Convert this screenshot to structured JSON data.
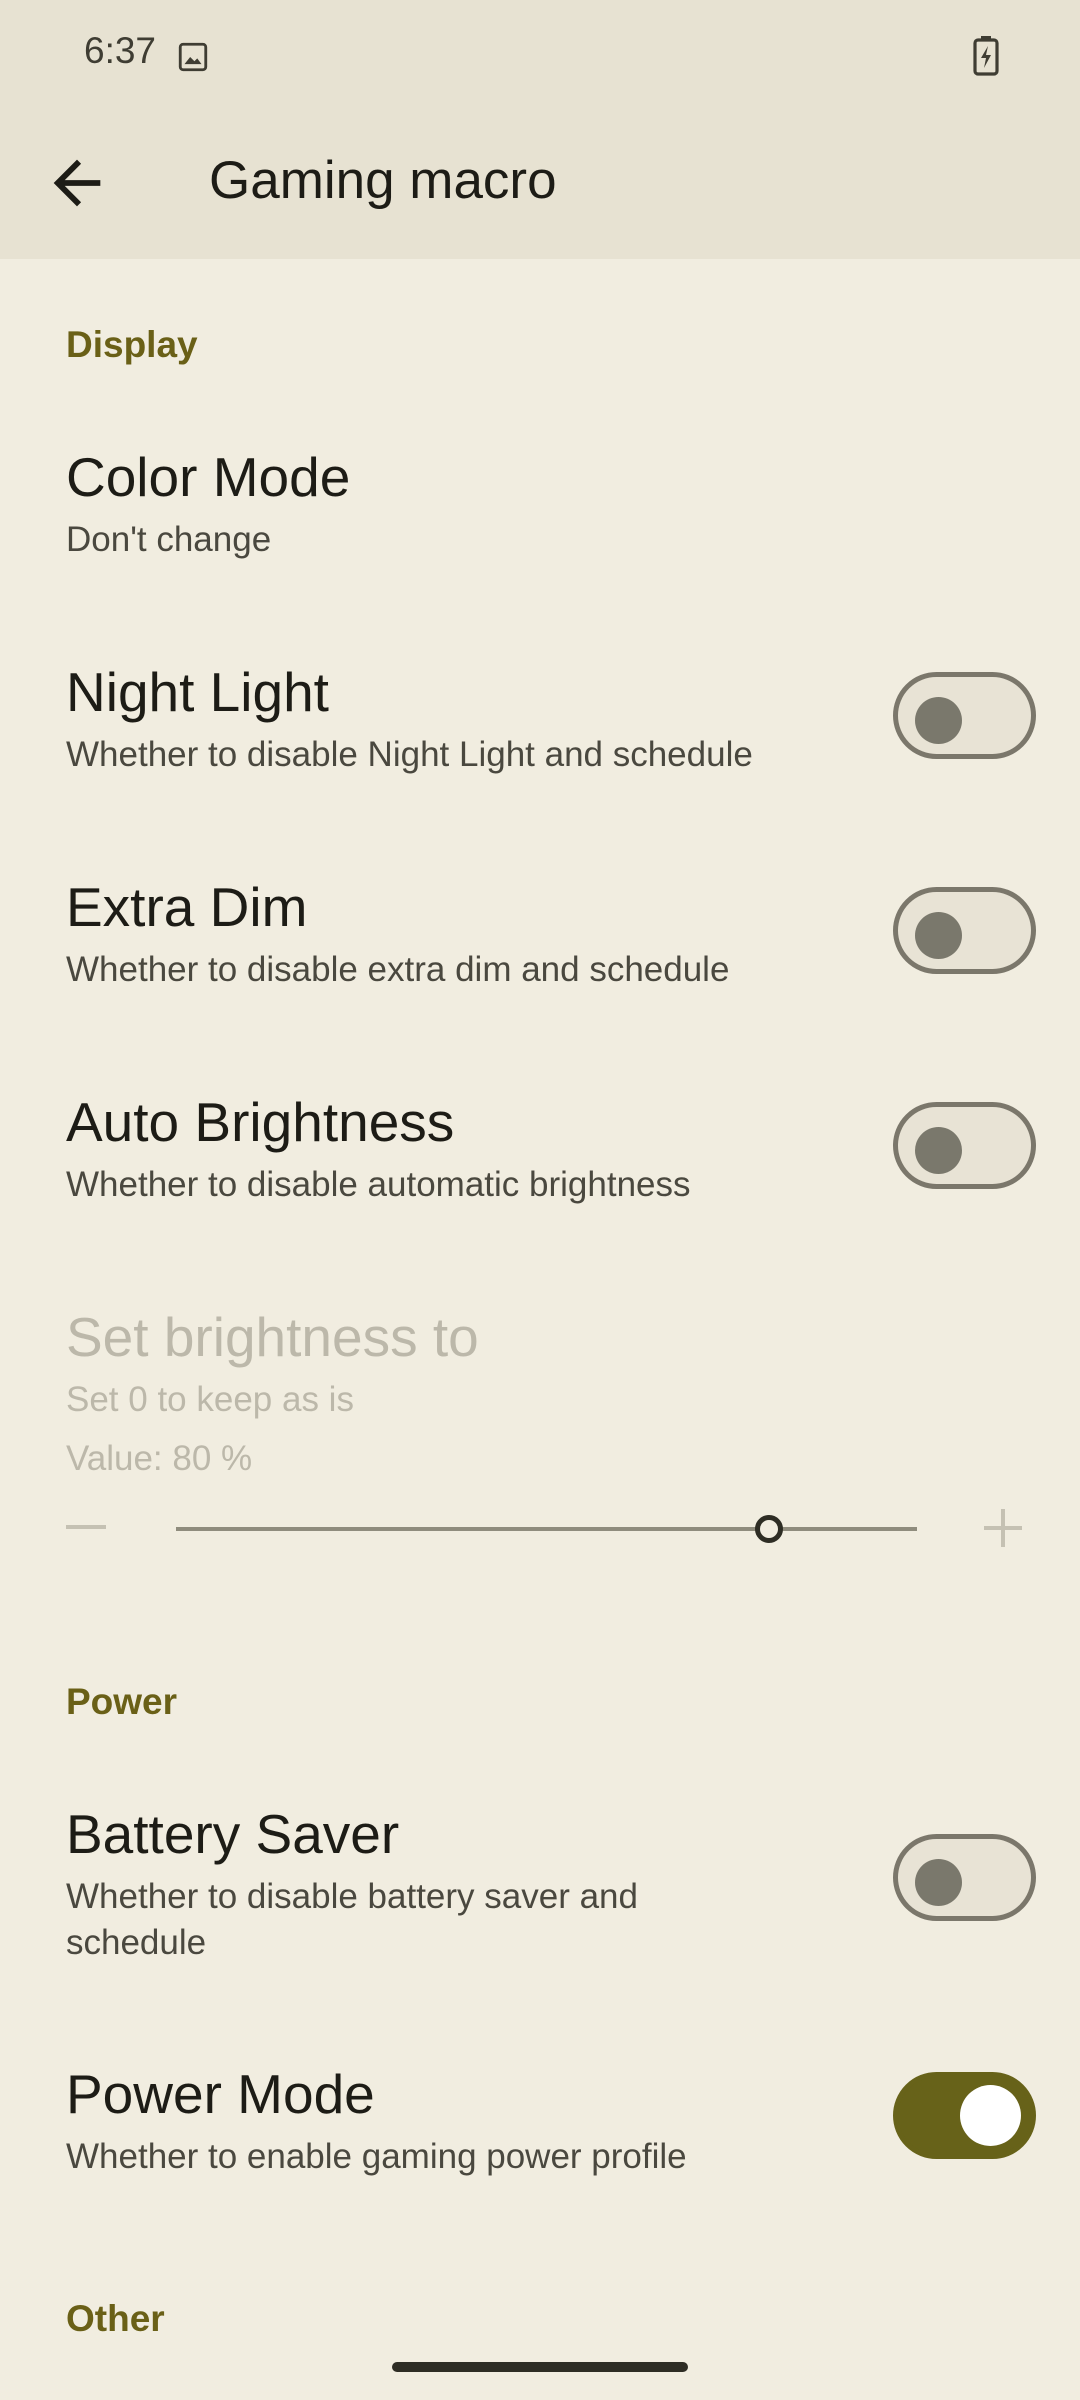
{
  "status_bar": {
    "time": "6:37"
  },
  "app_bar": {
    "title": "Gaming macro"
  },
  "sections": {
    "display": "Display",
    "power": "Power",
    "other": "Other"
  },
  "display_items": {
    "color_mode": {
      "title": "Color Mode",
      "subtitle": "Don't change"
    },
    "night_light": {
      "title": "Night Light",
      "subtitle": "Whether to disable Night Light and schedule",
      "enabled": false
    },
    "extra_dim": {
      "title": "Extra Dim",
      "subtitle": "Whether to disable extra dim and schedule",
      "enabled": false
    },
    "auto_brightness": {
      "title": "Auto Brightness",
      "subtitle": "Whether to disable automatic brightness",
      "enabled": false
    },
    "set_brightness": {
      "title": "Set brightness to",
      "subtitle": "Set 0 to keep as is",
      "value_label": "Value: 80 %",
      "value": 80
    }
  },
  "power_items": {
    "battery_saver": {
      "title": "Battery Saver",
      "subtitle": "Whether to disable battery saver and schedule",
      "enabled": false
    },
    "power_mode": {
      "title": "Power Mode",
      "subtitle": "Whether to enable gaming power profile",
      "enabled": true
    }
  },
  "colors": {
    "accent": "#676219",
    "background": "#f1ede0",
    "appbar": "#e7e2d2"
  }
}
